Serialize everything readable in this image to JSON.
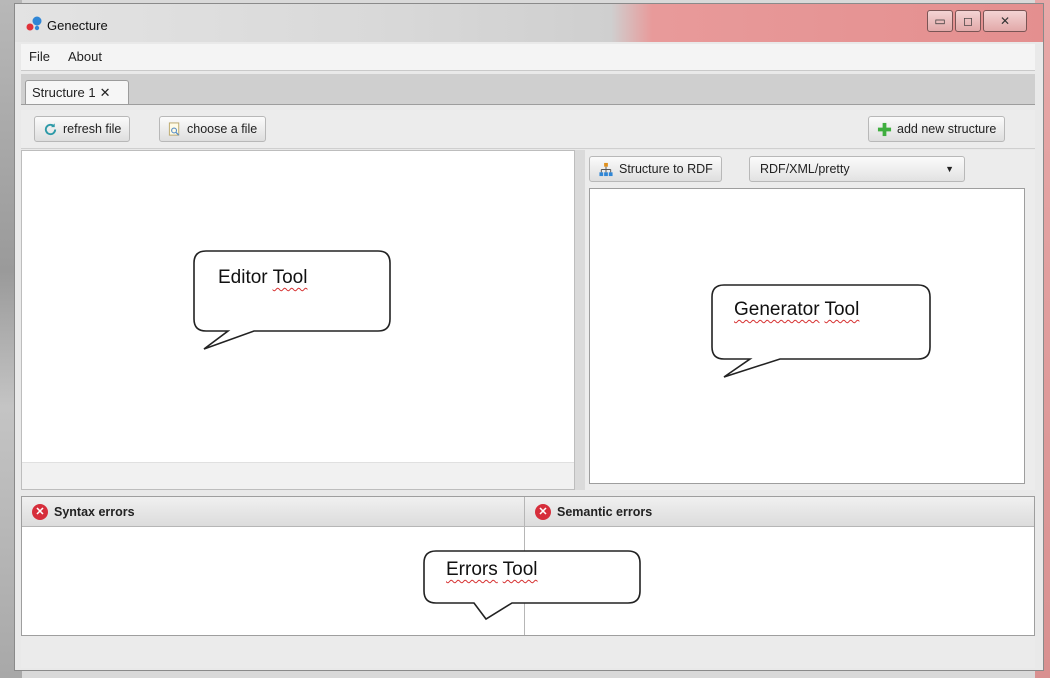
{
  "window": {
    "title": "Genecture",
    "controls": [
      "minimize",
      "maximize",
      "close"
    ]
  },
  "menubar": {
    "items": [
      "File",
      "About"
    ]
  },
  "tabs": [
    {
      "label": "Structure 1",
      "close_glyph": "✕"
    }
  ],
  "toolbar": {
    "refresh_label": "refresh file",
    "choose_label": "choose a file",
    "add_label": "add new structure"
  },
  "generator": {
    "button_label": "Structure to RDF",
    "format_selected": "RDF/XML/pretty"
  },
  "errors": {
    "syntax_title": "Syntax errors",
    "semantic_title": "Semantic errors"
  },
  "callouts": {
    "editor": [
      "Editor",
      "Tool"
    ],
    "generator": [
      "Generator",
      "Tool"
    ],
    "errors": [
      "Errors",
      "Tool"
    ]
  },
  "colors": {
    "accent_close": "#e48f8f",
    "error_icon": "#d62e3b",
    "add_icon": "#3fae3f",
    "refresh_icon": "#2e9aa8"
  },
  "icons": {
    "refresh": "refresh-icon",
    "choose": "file-search-icon",
    "add": "plus-icon",
    "rdf": "hierarchy-icon",
    "error": "error-icon"
  }
}
